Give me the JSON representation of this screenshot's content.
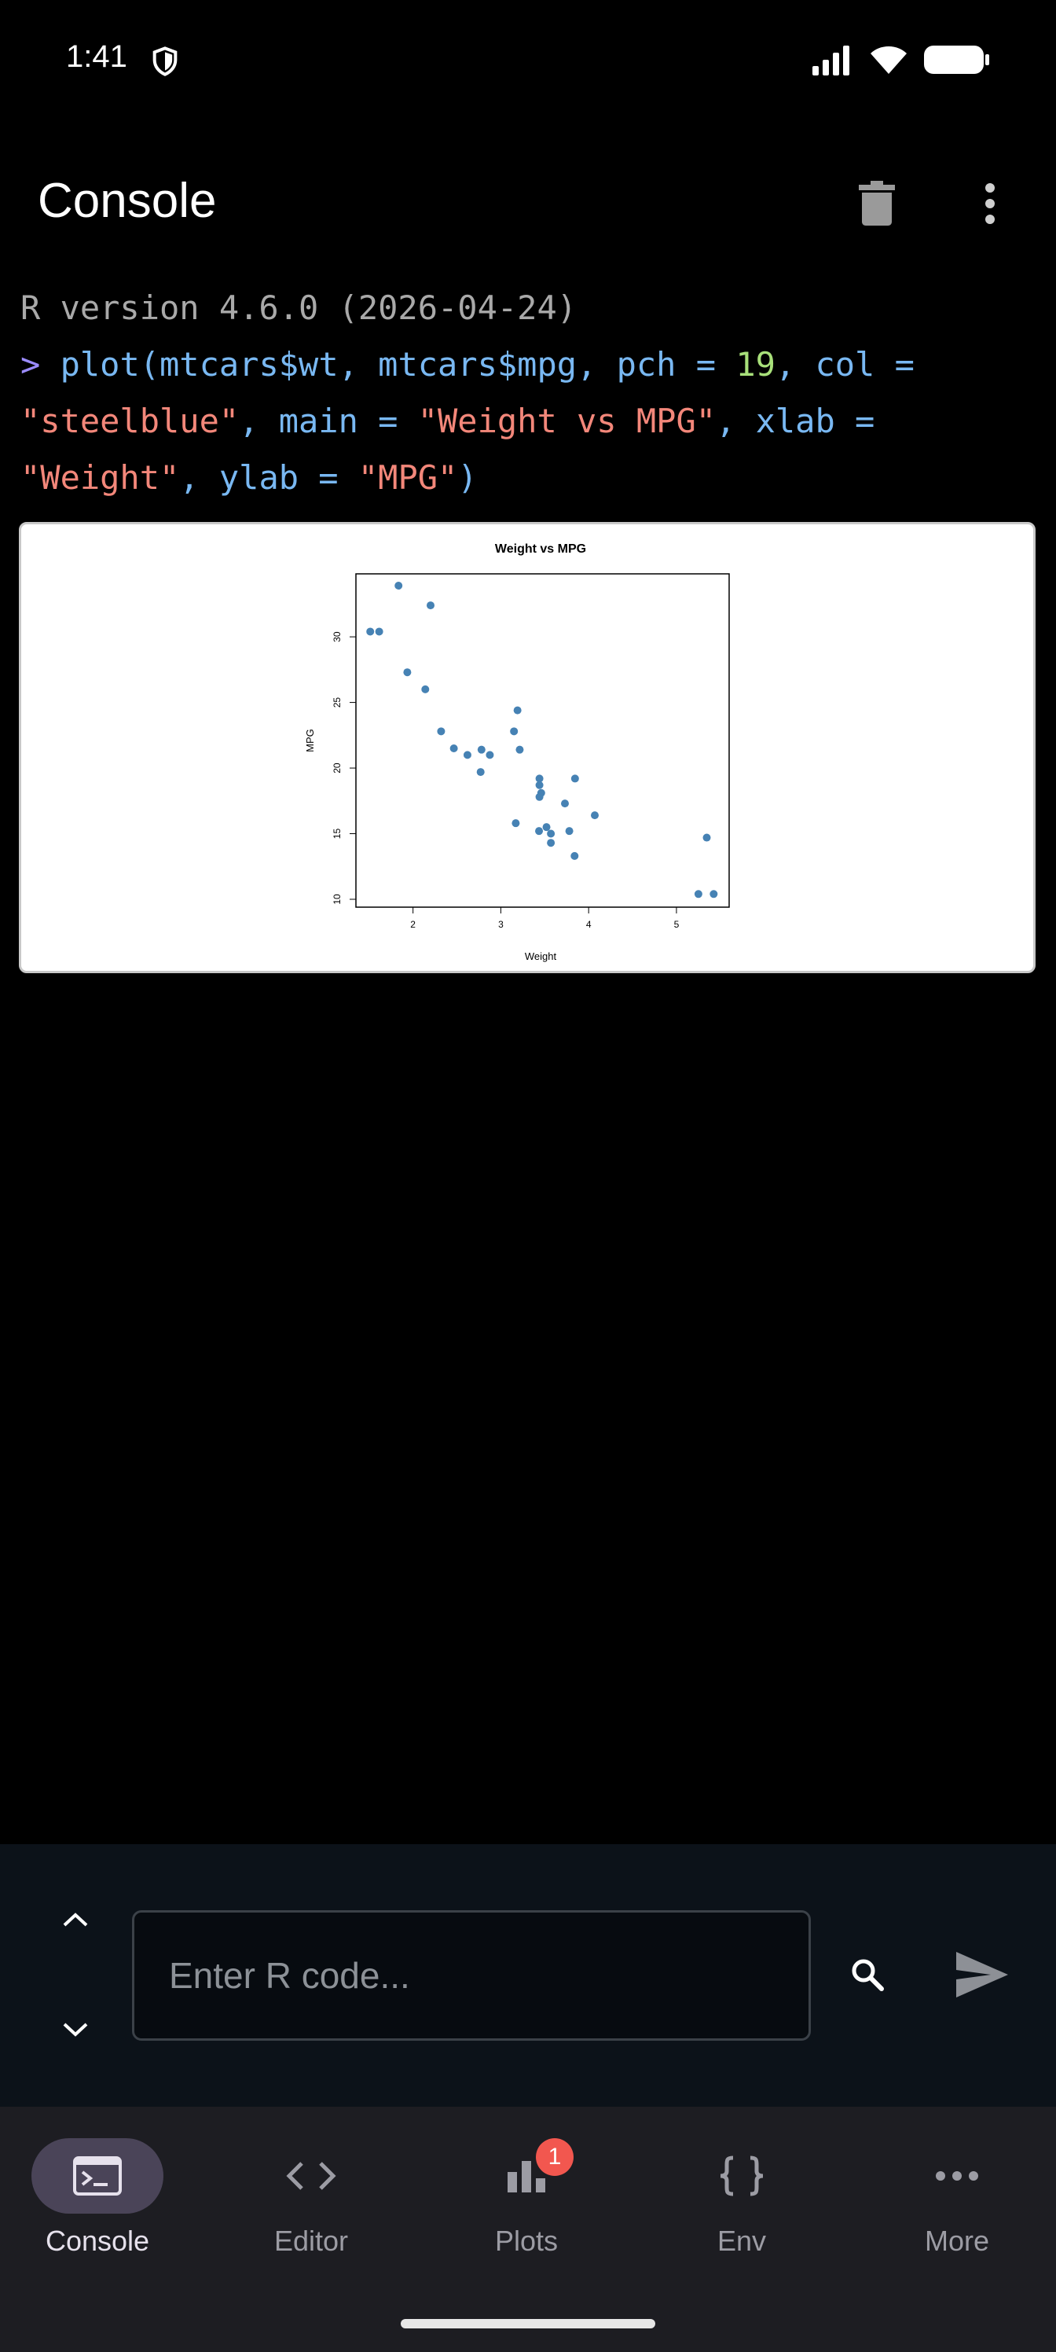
{
  "status_bar": {
    "time": "1:41"
  },
  "app_bar": {
    "title": "Console"
  },
  "console": {
    "version_line": "R version 4.6.0 (2026-04-24)",
    "prompt": ">",
    "command_tokens": {
      "t1": "plot(mtcars$wt, mtcars$mpg, pch = ",
      "t2": "19",
      "t3": ", col =",
      "t4": "\"steelblue\"",
      "t5": ", main = ",
      "t6": "\"Weight vs MPG\"",
      "t7": ", xlab =",
      "t8": "\"Weight\"",
      "t9": ", ylab = ",
      "t10": "\"MPG\"",
      "t11": ")"
    }
  },
  "chart_data": {
    "type": "scatter",
    "title": "Weight vs MPG",
    "xlabel": "Weight",
    "ylabel": "MPG",
    "xlim": [
      1.35,
      5.6
    ],
    "ylim": [
      9.4,
      34.8
    ],
    "xticks": [
      2,
      3,
      4,
      5
    ],
    "yticks": [
      10,
      15,
      20,
      25,
      30
    ],
    "point_color": "#4682b4",
    "series": [
      {
        "x": [
          2.62,
          2.875,
          2.32,
          3.215,
          3.44,
          3.46,
          3.57,
          3.19,
          3.15,
          3.44,
          3.44,
          4.07,
          3.73,
          3.78,
          5.25,
          5.424,
          5.345,
          2.2,
          1.615,
          1.835,
          2.465,
          3.52,
          3.435,
          3.84,
          3.845,
          1.935,
          2.14,
          1.513,
          3.17,
          2.77,
          3.57,
          2.78
        ],
        "y": [
          21.0,
          21.0,
          22.8,
          21.4,
          18.7,
          18.1,
          14.3,
          24.4,
          22.8,
          19.2,
          17.8,
          16.4,
          17.3,
          15.2,
          10.4,
          10.4,
          14.7,
          32.4,
          30.4,
          33.9,
          21.5,
          15.5,
          15.2,
          13.3,
          19.2,
          27.3,
          26.0,
          30.4,
          15.8,
          19.7,
          15.0,
          21.4
        ]
      }
    ],
    "grid": false,
    "legend": "none"
  },
  "input": {
    "placeholder": "Enter R code..."
  },
  "nav": {
    "items": [
      {
        "label": "Console"
      },
      {
        "label": "Editor"
      },
      {
        "label": "Plots",
        "badge": "1"
      },
      {
        "label": "Env"
      },
      {
        "label": "More"
      }
    ]
  },
  "colors": {
    "background": "#000000",
    "nav_background": "#1d1d22",
    "active_pill": "#4a4458",
    "badge": "#f2574f",
    "prompt": "#9c8cff",
    "code_blue": "#79b8f2",
    "code_string": "#f3877a",
    "code_number": "#a8e07a"
  }
}
